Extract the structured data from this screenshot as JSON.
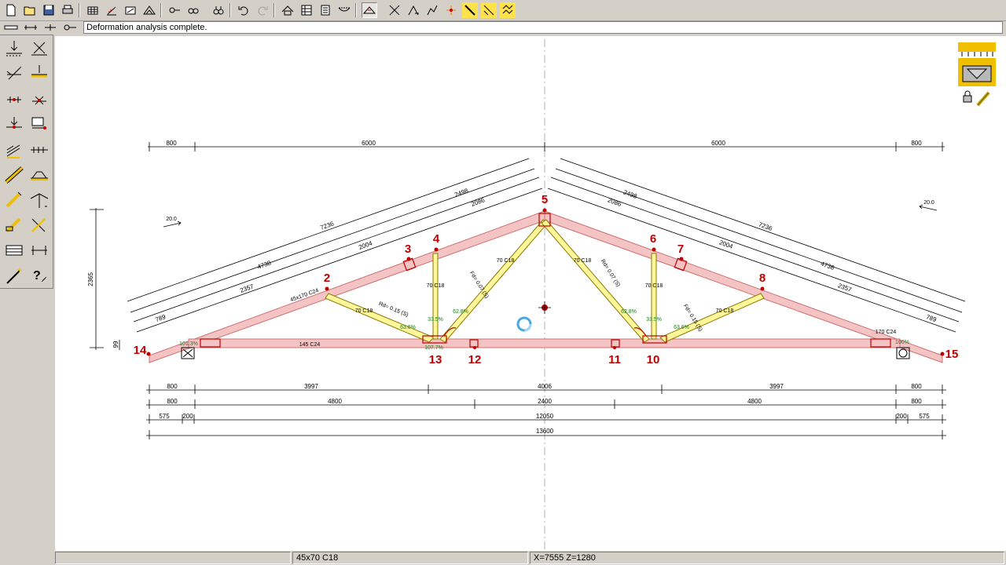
{
  "toolbar": {
    "buttons": [
      "new-file-icon",
      "open-folder-icon",
      "save-icon",
      "print-icon",
      "grid-icon",
      "load-icon",
      "angle-icon",
      "truss-icon",
      "connector-icon",
      "view-icon",
      "binoculars-icon",
      "undo-icon",
      "redo-icon",
      "roof-icon",
      "table-icon",
      "report-icon",
      "deflection-icon",
      "truss-view-icon",
      "axes-icon",
      "slope-icon",
      "line-icon",
      "star-icon",
      "member-icon",
      "member2-icon",
      "pattern-icon"
    ]
  },
  "message": "Deformation analysis complete.",
  "status": {
    "member": "45x70 C18",
    "coords": "X=7555  Z=1280"
  },
  "nodes": [
    "2",
    "3",
    "4",
    "5",
    "6",
    "7",
    "8",
    "10",
    "11",
    "12",
    "13",
    "14",
    "15"
  ],
  "top_dims": {
    "overhang_left": "800",
    "left_half": "6000",
    "right_half": "6000",
    "overhang_right": "800"
  },
  "rafter_dims": {
    "left": [
      "7236",
      "2498",
      "4738",
      "2086",
      "2004",
      "2357",
      "789"
    ],
    "right": [
      "2498",
      "7236",
      "2086",
      "2004",
      "4738",
      "2357",
      "789"
    ]
  },
  "bottom_dims": {
    "row1": [
      "800",
      "3997",
      "4006",
      "3997",
      "800"
    ],
    "row2": [
      "800",
      "4800",
      "2400",
      "4800",
      "800"
    ],
    "row3": [
      "575",
      "200",
      "12050",
      "200",
      "575"
    ],
    "total": "13600"
  },
  "height_dims": {
    "total": "2365",
    "small": "99"
  },
  "members": {
    "rafter_left": "45x170 C24",
    "bottom_chord": "145 C24",
    "web": "70 C18",
    "web_right_chord": "170 C24"
  },
  "utilization": {
    "left_support": "101.3%",
    "right_support": "100%",
    "mid_left": "107.7%",
    "w1": "63.6%",
    "w2": "33.5%",
    "w3": "62.8%"
  },
  "forces": {
    "f1": "Rd= 0.15 (S)",
    "f2": "Fd= 0.07 (S)",
    "f3": "Rd= 0.07 (S)",
    "f4": "Fd= 0.15 (S)"
  },
  "wind_labels": [
    "20.0",
    "20.0"
  ],
  "colors": {
    "rafter": "#f4c4c4",
    "rafter_stroke": "#d07070",
    "web": "#fff79a",
    "node": "#c00000",
    "background": "#d4d0c8"
  }
}
